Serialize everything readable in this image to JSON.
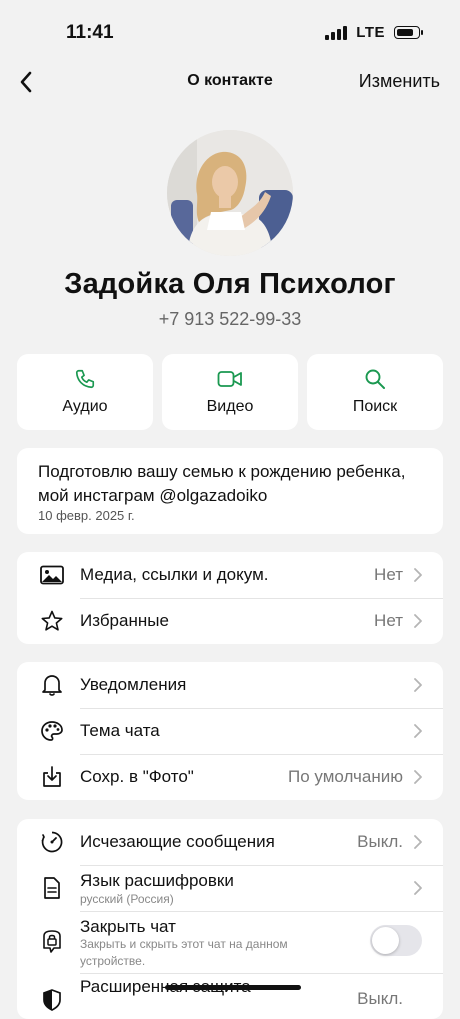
{
  "status_bar": {
    "time": "11:41",
    "network": "LTE",
    "signal_bars": 4,
    "battery_level": 0.85
  },
  "nav": {
    "title": "О контакте",
    "edit_label": "Изменить"
  },
  "contact": {
    "name": "Задойка Оля Психолог",
    "phone": "+7 913 522-99-33"
  },
  "actions": [
    {
      "label": "Аудио",
      "icon": "phone-icon"
    },
    {
      "label": "Видео",
      "icon": "video-icon"
    },
    {
      "label": "Поиск",
      "icon": "search-icon"
    }
  ],
  "about": {
    "text": "Подготовлю вашу семью к рождению ребенка, мой инстаграм @olgazadoiko",
    "date": "10 февр. 2025 г."
  },
  "group1": [
    {
      "label": "Медиа, ссылки и докум.",
      "value": "Нет",
      "icon": "image-icon"
    },
    {
      "label": "Избранные",
      "value": "Нет",
      "icon": "star-icon"
    }
  ],
  "group2": [
    {
      "label": "Уведомления",
      "value": "",
      "icon": "bell-icon"
    },
    {
      "label": "Тема чата",
      "value": "",
      "icon": "palette-icon"
    },
    {
      "label": "Сохр. в \"Фото\"",
      "value": "По умолчанию",
      "icon": "download-icon"
    }
  ],
  "group3": {
    "disappearing": {
      "label": "Исчезающие сообщения",
      "value": "Выкл."
    },
    "transcription": {
      "label": "Язык расшифровки",
      "sub": "русский (Россия)"
    },
    "lock_chat": {
      "label": "Закрыть чат",
      "sub_line1": "Закрыть и скрыть этот чат на данном",
      "sub_line2": "устройстве.",
      "enabled": false
    },
    "advanced": {
      "label": "Расширенная защита",
      "value": "Выкл."
    }
  },
  "colors": {
    "accent": "#1a9850",
    "background": "#f2f2f2",
    "card": "#ffffff"
  }
}
